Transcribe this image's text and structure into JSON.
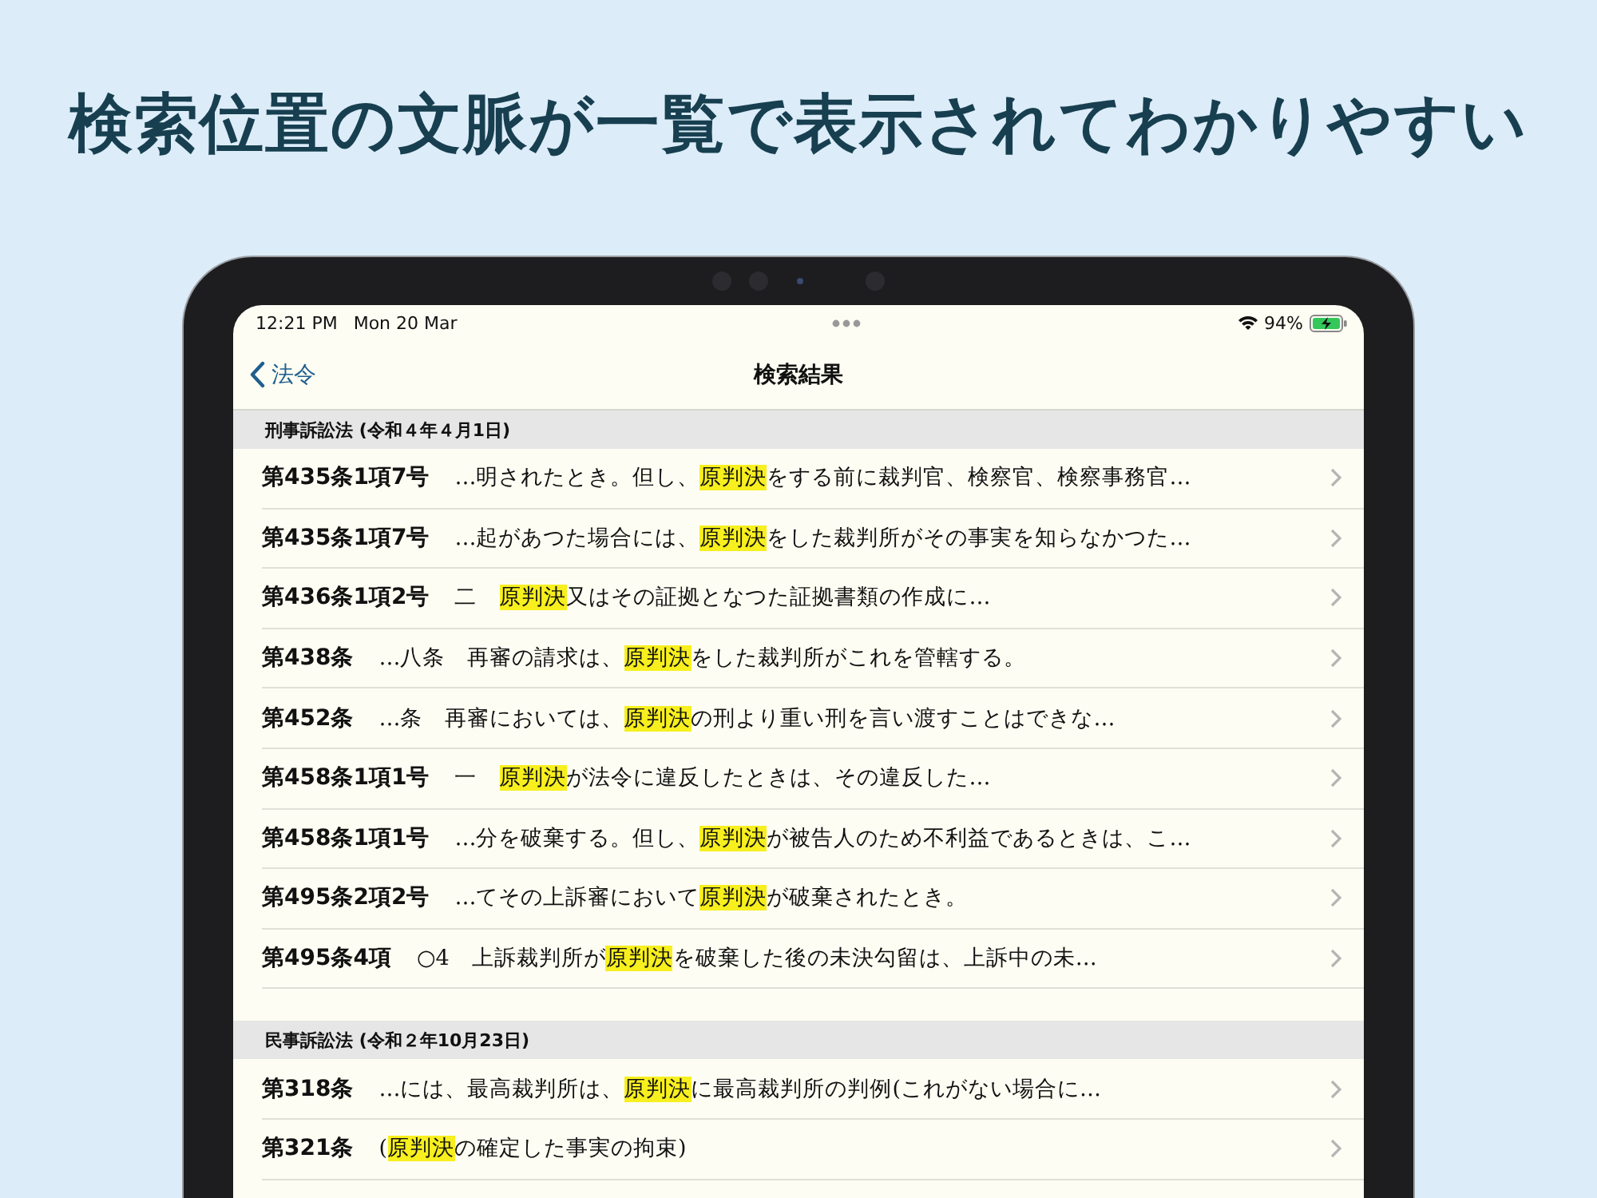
{
  "headline": "検索位置の文脈が一覧で表示されてわかりやすい",
  "status_bar": {
    "time": "12:21 PM",
    "date": "Mon 20 Mar",
    "battery": "94%"
  },
  "nav": {
    "back": "法令",
    "title": "検索結果"
  },
  "sections": [
    {
      "header": "刑事訴訟法 (令和４年４月1日)",
      "rows": [
        {
          "ref": "第435条1項7号",
          "before": "…明されたとき。但し、",
          "match": "原判決",
          "after": "をする前に裁判官、検察官、検察事務官…"
        },
        {
          "ref": "第435条1項7号",
          "before": "…起があつた場合には、",
          "match": "原判決",
          "after": "をした裁判所がその事実を知らなかつた…"
        },
        {
          "ref": "第436条1項2号",
          "before": "二　",
          "match": "原判決",
          "after": "又はその証拠となつた証拠書類の作成に…"
        },
        {
          "ref": "第438条",
          "before": "…八条　再審の請求は、",
          "match": "原判決",
          "after": "をした裁判所がこれを管轄する。"
        },
        {
          "ref": "第452条",
          "before": "…条　再審においては、",
          "match": "原判決",
          "after": "の刑より重い刑を言い渡すことはできな…"
        },
        {
          "ref": "第458条1項1号",
          "before": "一　",
          "match": "原判決",
          "after": "が法令に違反したときは、その違反した…"
        },
        {
          "ref": "第458条1項1号",
          "before": "…分を破棄する。但し、",
          "match": "原判決",
          "after": "が被告人のため不利益であるときは、こ…"
        },
        {
          "ref": "第495条2項2号",
          "before": "…てその上訴審において",
          "match": "原判決",
          "after": "が破棄されたとき。"
        },
        {
          "ref": "第495条4項",
          "before": "○4　上訴裁判所が",
          "match": "原判決",
          "after": "を破棄した後の未決勾留は、上訴中の未…"
        }
      ]
    },
    {
      "header": "民事訴訟法 (令和２年10月23日)",
      "rows": [
        {
          "ref": "第318条",
          "before": "…には、最高裁判所は、",
          "match": "原判決",
          "after": "に最高裁判所の判例(これがない場合に…"
        },
        {
          "ref": "第321条",
          "before": "(",
          "match": "原判決",
          "after": "の確定した事実の拘束)"
        }
      ]
    }
  ]
}
